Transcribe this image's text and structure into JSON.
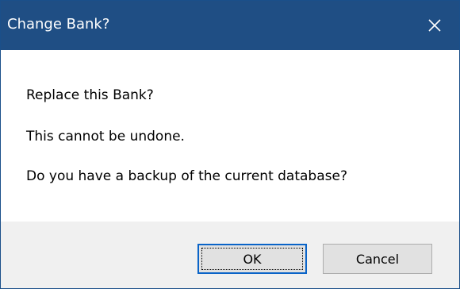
{
  "window": {
    "title": "Change Bank?",
    "close_glyph": "✕",
    "titlebar_color": "#1f4e84"
  },
  "message": {
    "line1": "Replace this Bank?",
    "line2": "This cannot be undone.",
    "line3": "Do you have a backup of the current database?"
  },
  "buttons": {
    "ok_label": "OK",
    "cancel_label": "Cancel"
  },
  "icons": {
    "close": "close-icon"
  }
}
